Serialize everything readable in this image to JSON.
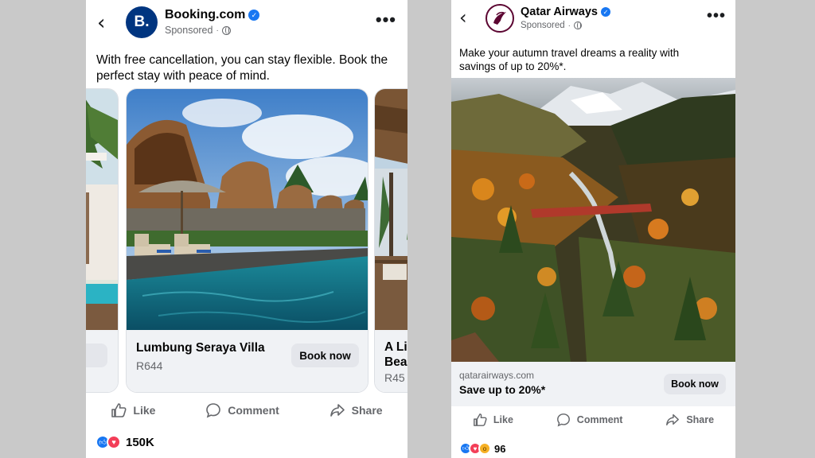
{
  "left_post": {
    "page_name": "Booking.com",
    "avatar_letter": "B.",
    "sponsored": "Sponsored",
    "text_line1": "With free cancellation, you can stay flexible. Book the",
    "text_line2": "perfect stay with peace of mind.",
    "carousel": {
      "prev_card_button": "ow",
      "main_card": {
        "title": "Lumbung Seraya Villa",
        "price": "R644",
        "button": "Book now"
      },
      "next_card": {
        "title_line1": "A Li",
        "title_line2": "Bea",
        "price": "R45"
      }
    },
    "actions": {
      "like": "Like",
      "comment": "Comment",
      "share": "Share"
    },
    "reaction_count": "150K",
    "colors": {
      "brand": "#003580",
      "verified": "#1877f2"
    }
  },
  "right_post": {
    "page_name": "Qatar Airways",
    "sponsored": "Sponsored",
    "text_line1": "Make your autumn travel dreams a reality with",
    "text_line2": "savings of up to 20%*.",
    "link": {
      "domain": "qatarairways.com",
      "headline": "Save up to 20%*",
      "button": "Book now"
    },
    "actions": {
      "like": "Like",
      "comment": "Comment",
      "share": "Share"
    },
    "reaction_count": "96",
    "colors": {
      "brand": "#5c0632"
    }
  }
}
